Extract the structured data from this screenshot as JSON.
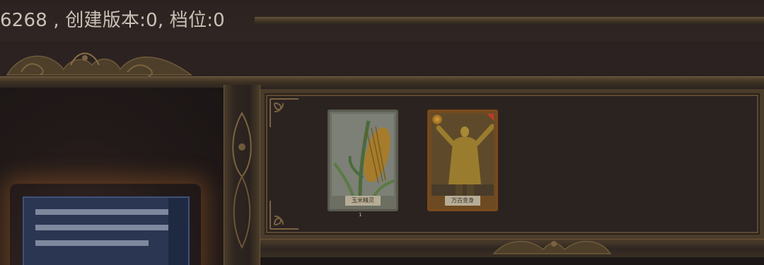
{
  "status_text": "6268 , 创建版本:0, 档位:0",
  "cards": [
    {
      "id": "corn",
      "label": "玉米精灵",
      "sub_label": "1"
    },
    {
      "id": "golden-god",
      "label": "万古金身",
      "sub_label": ""
    }
  ],
  "colors": {
    "frame_gold": "#5c4a31",
    "background": "#2b2220",
    "storage_box": "#2a3652"
  }
}
